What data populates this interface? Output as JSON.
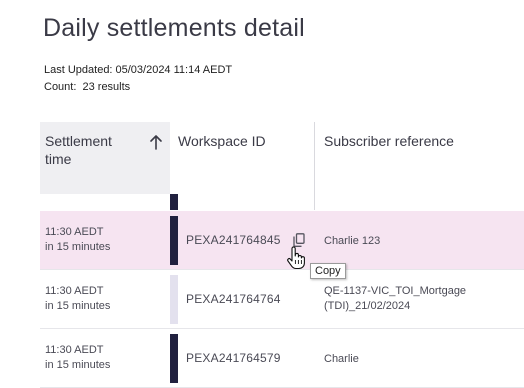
{
  "page": {
    "title": "Daily settlements detail",
    "last_updated_label": "Last Updated:",
    "last_updated_value": "05/03/2024 11:14 AEDT",
    "count_label": "Count:",
    "count_value": "23 results"
  },
  "table": {
    "columns": {
      "settlement_time": "Settlement time",
      "workspace_id": "Workspace ID",
      "subscriber_reference": "Subscriber reference"
    },
    "sort": {
      "column": "settlement_time",
      "direction": "ascending",
      "icon": "arrow-up-icon"
    },
    "rows": [
      {
        "time": "11:30 AEDT",
        "relative": "in 15 minutes",
        "workspace_id": "PEXA241764845",
        "subscriber_reference": [
          "Charlie 123"
        ],
        "highlighted": true,
        "status_color": "#21213f"
      },
      {
        "time": "11:30 AEDT",
        "relative": "in 15 minutes",
        "workspace_id": "PEXA241764764",
        "subscriber_reference": [
          "QE-1137-VIC_TOI_Mortgage",
          "(TDI)_21/02/2024"
        ],
        "highlighted": false,
        "status_color": "#e3e1ee"
      },
      {
        "time": "11:30 AEDT",
        "relative": "in 15 minutes",
        "workspace_id": "PEXA241764579",
        "subscriber_reference": [
          "Charlie"
        ],
        "highlighted": false,
        "status_color": "#21213f"
      }
    ]
  },
  "tooltip": {
    "text": "Copy"
  },
  "colors": {
    "highlight_row": "#f6e4f1",
    "header_bg": "#efeff2",
    "status_dark": "#21213f",
    "status_light": "#e3e1ee"
  }
}
